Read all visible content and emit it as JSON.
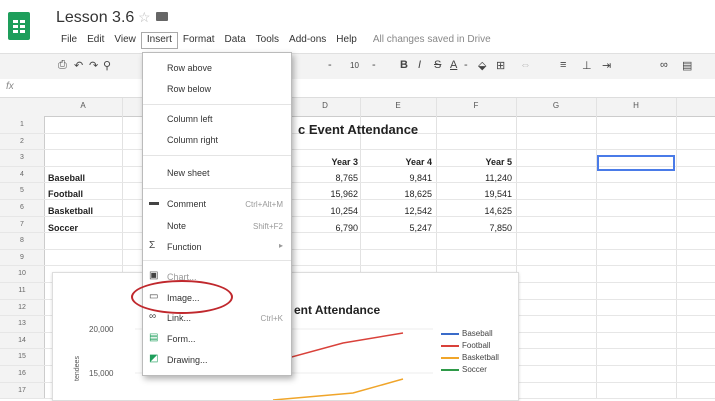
{
  "app": {
    "doc_title": "Lesson 3.6",
    "menus": [
      "File",
      "Edit",
      "View",
      "Insert",
      "Format",
      "Data",
      "Tools",
      "Add-ons",
      "Help"
    ],
    "save_status": "All changes saved in Drive"
  },
  "toolbar": {
    "font_size": "10",
    "bold": "B",
    "italic": "I",
    "strike": "S",
    "text_color": "A"
  },
  "formula_bar": {
    "fx": "fx"
  },
  "grid": {
    "columns": [
      "A",
      "D",
      "E",
      "F",
      "G",
      "H"
    ],
    "rows": [
      "1",
      "2",
      "3",
      "4",
      "5",
      "6",
      "7",
      "8",
      "9",
      "10",
      "11",
      "12",
      "13",
      "14",
      "15",
      "16",
      "17"
    ],
    "title": "c Event Attendance",
    "headers": [
      "Year 3",
      "Year 4",
      "Year 5"
    ],
    "data": [
      {
        "sport": "Baseball",
        "values": [
          "8,765",
          "9,841",
          "11,240"
        ]
      },
      {
        "sport": "Football",
        "values": [
          "15,962",
          "18,625",
          "19,541"
        ]
      },
      {
        "sport": "Basketball",
        "values": [
          "10,254",
          "12,542",
          "14,625"
        ]
      },
      {
        "sport": "Soccer",
        "values": [
          "6,790",
          "5,247",
          "7,850"
        ]
      }
    ]
  },
  "chart": {
    "title": "ent Attendance",
    "ytick_top": "20,000",
    "ytick_mid": "15,000",
    "legend": [
      {
        "name": "Baseball",
        "color": "#3a6bc9"
      },
      {
        "name": "Football",
        "color": "#d9413a"
      },
      {
        "name": "Basketball",
        "color": "#f0a52a"
      },
      {
        "name": "Soccer",
        "color": "#2e9a48"
      }
    ]
  },
  "insert_menu": {
    "row_above": "Row above",
    "row_below": "Row below",
    "column_left": "Column left",
    "column_right": "Column right",
    "new_sheet": "New sheet",
    "comment": "Comment",
    "comment_shortcut": "Ctrl+Alt+M",
    "note": "Note",
    "note_shortcut": "Shift+F2",
    "function": "Function",
    "chart": "Chart...",
    "image": "Image...",
    "link": "Link...",
    "link_shortcut": "Ctrl+K",
    "form": "Form...",
    "drawing": "Drawing..."
  }
}
